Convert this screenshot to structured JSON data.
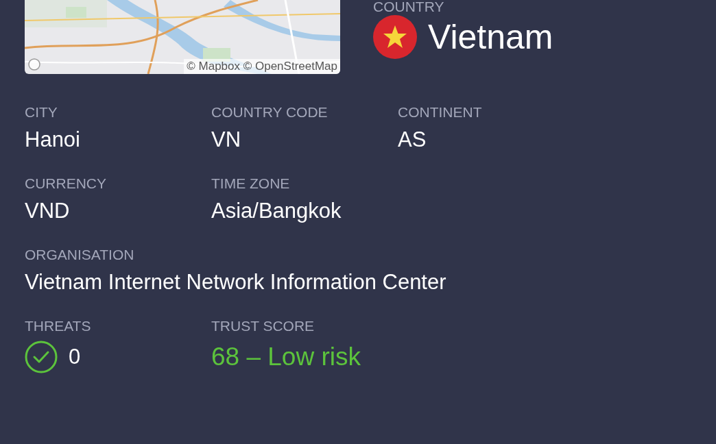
{
  "map": {
    "attribution": "© Mapbox © OpenStreetMap"
  },
  "country": {
    "label": "COUNTRY",
    "value": "Vietnam"
  },
  "rows": [
    [
      {
        "label": "CITY",
        "value": "Hanoi"
      },
      {
        "label": "COUNTRY CODE",
        "value": "VN"
      },
      {
        "label": "CONTINENT",
        "value": "AS"
      }
    ],
    [
      {
        "label": "CURRENCY",
        "value": "VND"
      },
      {
        "label": "TIME ZONE",
        "value": "Asia/Bangkok"
      }
    ],
    [
      {
        "label": "ORGANISATION",
        "value": "Vietnam Internet Network Information Center"
      }
    ]
  ],
  "threats": {
    "label": "THREATS",
    "value": "0"
  },
  "trust": {
    "label": "TRUST SCORE",
    "value": "68 – Low risk"
  }
}
